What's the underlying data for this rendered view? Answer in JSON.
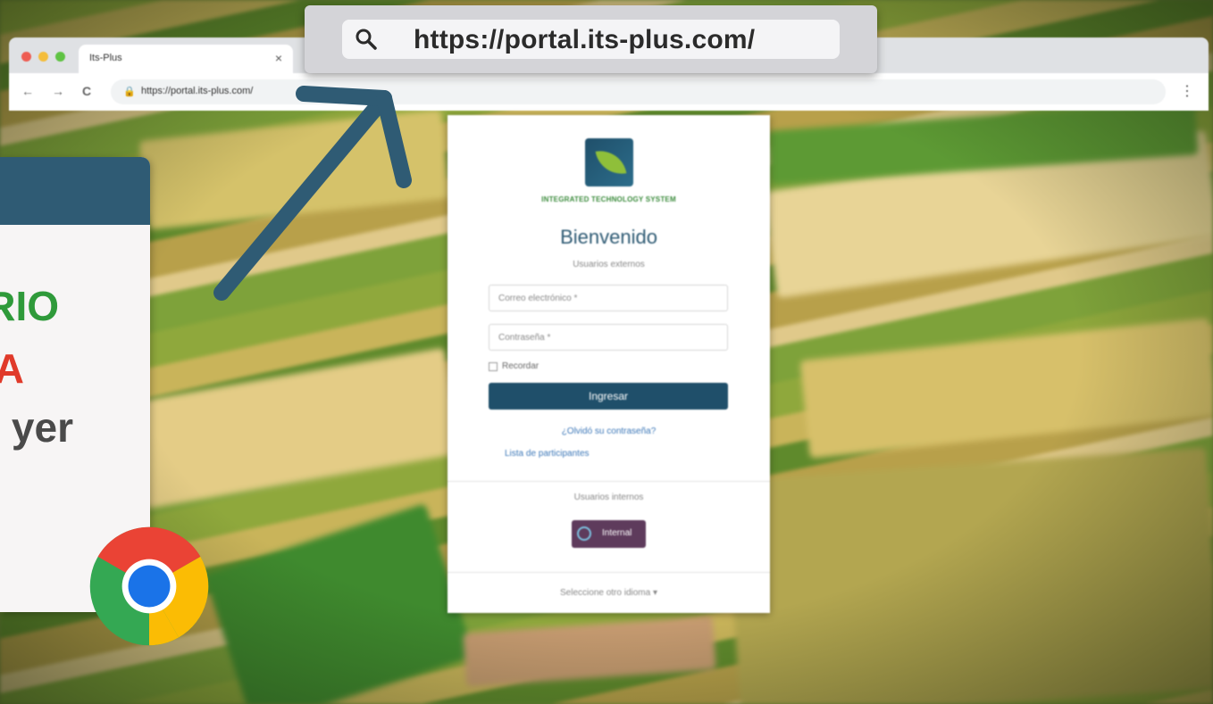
{
  "browser": {
    "tab_title": "Its-Plus",
    "tab_close": "×",
    "address_url": "https://portal.its-plus.com/",
    "nav": {
      "back": "←",
      "forward": "→",
      "reload": "C",
      "lock": "🔒",
      "menu": "⋮"
    }
  },
  "callout": {
    "url": "https://portal.its-plus.com/",
    "icon": "search-icon"
  },
  "side_card": {
    "line1": "RIO",
    "line2": "A",
    "line3": "yer"
  },
  "login": {
    "brand": "INTEGRATED TECHNOLOGY SYSTEM",
    "welcome": "Bienvenido",
    "subtitle": "Usuarios externos",
    "email_placeholder": "Correo electrónico *",
    "password_placeholder": "Contraseña *",
    "remember": "Recordar",
    "login_button": "Ingresar",
    "forgot": "¿Olvidó su contraseña?",
    "participants": "Lista de participantes",
    "internal_label": "Usuarios internos",
    "internal_button": "Internal",
    "language": "Seleccione otro idioma ▾"
  },
  "colors": {
    "primary": "#1f4f6a",
    "accent_green": "#2f9a3a",
    "accent_red": "#e03a2a",
    "internal_button": "#5e3b5c",
    "arrow": "#2f5b74"
  }
}
